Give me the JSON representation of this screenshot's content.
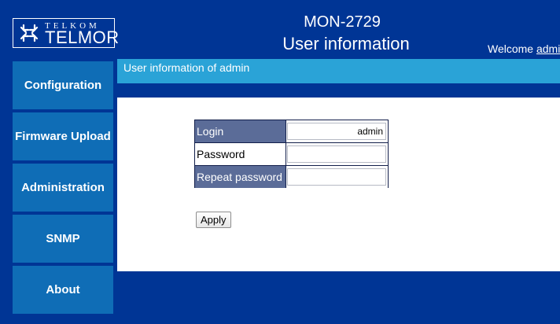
{
  "header": {
    "logo_top": "TELKOM",
    "logo_main": "TELMOR",
    "device": "MON-2729",
    "title": "User information",
    "welcome_label": "Welcome",
    "welcome_user": "admi"
  },
  "sidebar": {
    "items": [
      {
        "label": "Configuration"
      },
      {
        "label": "Firmware Upload"
      },
      {
        "label": "Administration"
      },
      {
        "label": "SNMP"
      },
      {
        "label": "About"
      }
    ]
  },
  "section": {
    "title": "User information of admin"
  },
  "form": {
    "login_label": "Login",
    "login_value": "admin",
    "password_label": "Password",
    "password_value": "",
    "repeat_label": "Repeat password",
    "repeat_value": "",
    "apply_label": "Apply"
  },
  "colors": {
    "frame": "#003595",
    "sidebar_item": "#0f6db6",
    "section_bar": "#2aa3d7",
    "label_dark": "#5b6c98"
  }
}
